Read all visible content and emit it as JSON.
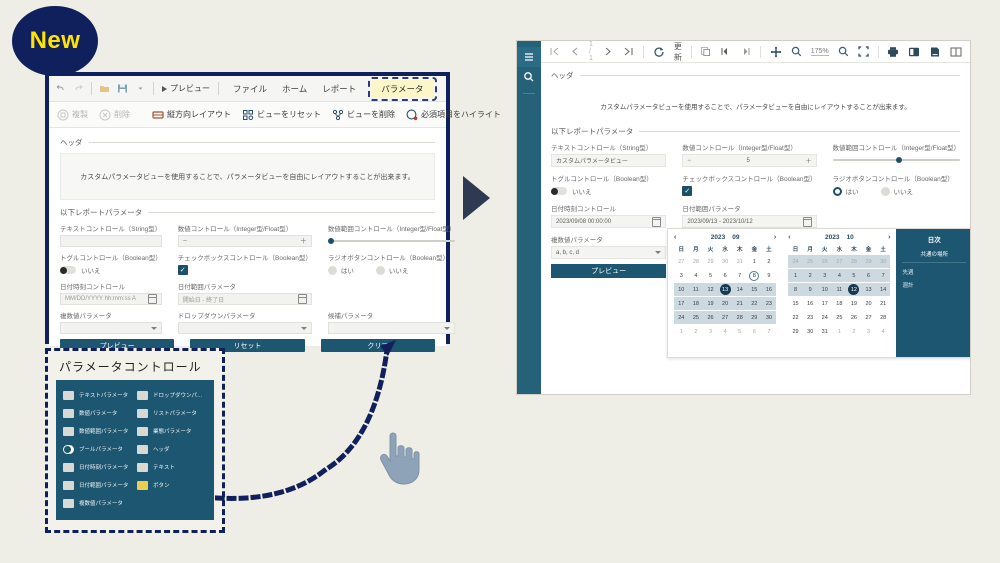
{
  "badge": {
    "label": "New"
  },
  "designer": {
    "quick_access": [
      "undo-icon",
      "redo-icon",
      "folder-icon",
      "save-icon",
      "dropdown-icon"
    ],
    "play_label": "プレビュー",
    "tabs": [
      {
        "label": "ファイル",
        "active": false
      },
      {
        "label": "ホーム",
        "active": false
      },
      {
        "label": "レポート",
        "active": false
      },
      {
        "label": "パラメータ",
        "active": true
      }
    ],
    "toolbar": [
      {
        "label": "複製",
        "icon": "copy-icon",
        "dim": true
      },
      {
        "label": "削除",
        "icon": "delete-icon",
        "dim": true
      },
      {
        "label": "縦方向レイアウト",
        "icon": "layout-icon",
        "dim": false
      },
      {
        "label": "ビューをリセット",
        "icon": "reset-icon",
        "dim": false
      },
      {
        "label": "ビューを削除",
        "icon": "remove-view-icon",
        "dim": false
      },
      {
        "label": "必須項目をハイライト",
        "icon": "highlight-icon",
        "dim": false
      }
    ],
    "header_section_label": "ヘッダ",
    "header_text": "カスタムパラメータビューを使用することで、パラメータビューを自由にレイアウトすることが出来ます。",
    "params_section_label": "以下レポートパラメータ",
    "fields": {
      "text_label": "テキストコントロール（String型）",
      "text_value": "",
      "number_label": "数値コントロール（Integer型/Float型）",
      "number_minus": "−",
      "number_plus": "＋",
      "range_label": "数値範囲コントロール（Integer型/Float型）",
      "toggle_label": "トグルコントロール（Boolean型）",
      "toggle_value": "いいえ",
      "checkbox_label": "チェックボックスコントロール（Boolean型）",
      "radio_label": "ラジオボタンコントロール（Boolean型）",
      "radio_yes": "はい",
      "radio_no": "いいえ",
      "datetime_label": "日付時刻コントロール",
      "datetime_placeholder": "MM/DD/YYYY hh:mm:ss A",
      "daterange_label": "日付範囲パラメータ",
      "daterange_placeholder": "開始日 - 終了日",
      "multi_label": "複数値パラメータ",
      "dropdown_label": "ドロップダウンパラメータ",
      "list_label": "候補パラメータ"
    },
    "buttons": {
      "preview": "プレビュー",
      "reset": "リセット",
      "clear": "クリア"
    }
  },
  "palette": {
    "title": "パラメータコントロール",
    "items": [
      {
        "label": "テキストパラメータ",
        "icon": "text-param-icon"
      },
      {
        "label": "ドロップダウンパ…",
        "icon": "dropdown-param-icon"
      },
      {
        "label": "数値パラメータ",
        "icon": "number-param-icon"
      },
      {
        "label": "リストパラメータ",
        "icon": "list-param-icon"
      },
      {
        "label": "数値範囲パラメータ",
        "icon": "number-range-param-icon"
      },
      {
        "label": "業態パラメータ",
        "icon": "category-param-icon"
      },
      {
        "label": "ブールパラメータ",
        "icon": "bool-param-icon"
      },
      {
        "label": "ヘッダ",
        "icon": "header-param-icon"
      },
      {
        "label": "日付時刻パラメータ",
        "icon": "datetime-param-icon"
      },
      {
        "label": "テキスト",
        "icon": "text-icon"
      },
      {
        "label": "日付範囲パラメータ",
        "icon": "daterange-param-icon"
      },
      {
        "label": "ボタン",
        "icon": "button-icon"
      },
      {
        "label": "複数値パラメータ",
        "icon": "multivalue-param-icon"
      }
    ]
  },
  "viewer": {
    "sidebar": [
      {
        "icon": "hamburger-icon",
        "selected": true
      },
      {
        "icon": "search-icon",
        "selected": false
      }
    ],
    "toolbar": {
      "first_page": "first-page-icon",
      "prev_page": "prev-page-icon",
      "page_indicator": "1 / 1",
      "next_page": "next-page-icon",
      "last_page": "last-page-icon",
      "refresh_icon": "refresh-icon",
      "refresh_label": "更新",
      "copy_icon": "copy-icon",
      "prev_view_icon": "prev-view-icon",
      "next_view_icon": "next-view-icon",
      "pan_icon": "pan-icon",
      "zoom_out_icon": "zoom-out-icon",
      "zoom_level": "175%",
      "zoom_in_icon": "zoom-in-icon",
      "fit_icon": "fit-screen-icon",
      "print_icon": "print-icon",
      "book_icon": "book-view-icon",
      "export_icon": "export-icon",
      "layout_icon": "page-layout-icon"
    },
    "header_section_label": "ヘッダ",
    "header_text": "カスタムパラメータビューを使用することで、パラメータビューを自由にレイアウトすることが出来ます。",
    "params_section_label": "以下レポートパラメータ",
    "fields": {
      "text_label": "テキストコントロール（String型）",
      "text_value": "カスタムパラメータビュー",
      "number_label": "数値コントロール（Integer型/Float型）",
      "number_value": "5",
      "number_minus": "−",
      "number_plus": "＋",
      "range_label": "数値範囲コントロール（Integer型/Float型）",
      "toggle_label": "トグルコントロール（Boolean型）",
      "toggle_value": "いいえ",
      "checkbox_label": "チェックボックスコントロール（Boolean型）",
      "radio_label": "ラジオボタンコントロール（Boolean型）",
      "radio_yes": "はい",
      "radio_no": "いいえ",
      "datetime_label": "日付時刻コントロール",
      "datetime_value": "2023/09/08 00:00:00",
      "daterange_label": "日付範囲パラメータ",
      "daterange_value": "2023/09/13 - 2023/10/12",
      "multi_label": "複数値パラメータ",
      "multi_value": "a, b, c, d",
      "preview_button": "プレビュー"
    },
    "calendar": {
      "dow": [
        "日",
        "月",
        "火",
        "水",
        "木",
        "金",
        "土"
      ],
      "left": {
        "year": "2023",
        "month": "09",
        "weeks": [
          {
            "highlight": false,
            "days": [
              {
                "n": "27",
                "mut": true
              },
              {
                "n": "28",
                "mut": true
              },
              {
                "n": "29",
                "mut": true
              },
              {
                "n": "30",
                "mut": true
              },
              {
                "n": "31",
                "mut": true
              },
              {
                "n": "1",
                "mut": false
              },
              {
                "n": "2",
                "mut": false
              }
            ]
          },
          {
            "highlight": false,
            "days": [
              {
                "n": "3"
              },
              {
                "n": "4"
              },
              {
                "n": "5"
              },
              {
                "n": "6"
              },
              {
                "n": "7"
              },
              {
                "n": "8",
                "today": true
              },
              {
                "n": "9"
              }
            ]
          },
          {
            "highlight": true,
            "days": [
              {
                "n": "10"
              },
              {
                "n": "11"
              },
              {
                "n": "12"
              },
              {
                "n": "13",
                "sel": true
              },
              {
                "n": "14"
              },
              {
                "n": "15"
              },
              {
                "n": "16"
              }
            ]
          },
          {
            "highlight": true,
            "days": [
              {
                "n": "17"
              },
              {
                "n": "18"
              },
              {
                "n": "19"
              },
              {
                "n": "20"
              },
              {
                "n": "21"
              },
              {
                "n": "22"
              },
              {
                "n": "23"
              }
            ]
          },
          {
            "highlight": true,
            "days": [
              {
                "n": "24"
              },
              {
                "n": "25"
              },
              {
                "n": "26"
              },
              {
                "n": "27"
              },
              {
                "n": "28"
              },
              {
                "n": "29"
              },
              {
                "n": "30"
              }
            ]
          },
          {
            "highlight": false,
            "days": [
              {
                "n": "1",
                "mut": true
              },
              {
                "n": "2",
                "mut": true
              },
              {
                "n": "3",
                "mut": true
              },
              {
                "n": "4",
                "mut": true
              },
              {
                "n": "5",
                "mut": true
              },
              {
                "n": "6",
                "mut": true
              },
              {
                "n": "7",
                "mut": true
              }
            ]
          }
        ]
      },
      "right": {
        "year": "2023",
        "month": "10",
        "weeks": [
          {
            "highlight": true,
            "days": [
              {
                "n": "24",
                "mut": true
              },
              {
                "n": "25",
                "mut": true
              },
              {
                "n": "26",
                "mut": true
              },
              {
                "n": "27",
                "mut": true
              },
              {
                "n": "28",
                "mut": true
              },
              {
                "n": "29",
                "mut": true
              },
              {
                "n": "30",
                "mut": true
              }
            ]
          },
          {
            "highlight": true,
            "days": [
              {
                "n": "1"
              },
              {
                "n": "2"
              },
              {
                "n": "3"
              },
              {
                "n": "4"
              },
              {
                "n": "5"
              },
              {
                "n": "6"
              },
              {
                "n": "7"
              }
            ]
          },
          {
            "highlight": true,
            "days": [
              {
                "n": "8"
              },
              {
                "n": "9"
              },
              {
                "n": "10"
              },
              {
                "n": "11"
              },
              {
                "n": "12",
                "sel": true
              },
              {
                "n": "13"
              },
              {
                "n": "14"
              }
            ]
          },
          {
            "highlight": false,
            "days": [
              {
                "n": "15"
              },
              {
                "n": "16"
              },
              {
                "n": "17"
              },
              {
                "n": "18"
              },
              {
                "n": "19"
              },
              {
                "n": "20"
              },
              {
                "n": "21"
              }
            ]
          },
          {
            "highlight": false,
            "days": [
              {
                "n": "22"
              },
              {
                "n": "23"
              },
              {
                "n": "24"
              },
              {
                "n": "25"
              },
              {
                "n": "26"
              },
              {
                "n": "27"
              },
              {
                "n": "28"
              }
            ]
          },
          {
            "highlight": false,
            "days": [
              {
                "n": "29"
              },
              {
                "n": "30"
              },
              {
                "n": "31"
              },
              {
                "n": "1",
                "mut": true
              },
              {
                "n": "2",
                "mut": true
              },
              {
                "n": "3",
                "mut": true
              },
              {
                "n": "4",
                "mut": true
              }
            ]
          }
        ]
      },
      "side": {
        "title": "日次",
        "subtitle": "共通の場所",
        "items": [
          "先週",
          "週計"
        ]
      }
    }
  },
  "colors": {
    "navy": "#10205c",
    "teal": "#1d5670",
    "sidebar_teal": "#26617a",
    "yellow": "#ffe400",
    "highlight_tab": "#fdf6c8",
    "page_bg": "#efeee6"
  }
}
